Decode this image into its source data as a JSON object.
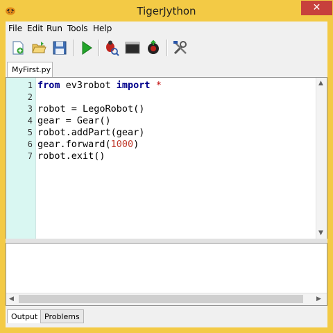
{
  "window": {
    "title": "TigerJython",
    "close_glyph": "✕"
  },
  "menu": [
    "File",
    "Edit",
    "Run",
    "Tools",
    "Help"
  ],
  "toolbar": {
    "buttons": [
      "new-file-icon",
      "open-folder-icon",
      "save-disk-icon",
      "run-play-icon",
      "debug-bug-icon",
      "console-terminal-icon",
      "robot-upload-icon",
      "tools-wrench-icon"
    ]
  },
  "tabs": {
    "active_file": "MyFirst.py"
  },
  "editor": {
    "line_numbers": [
      "1",
      "2",
      "3",
      "4",
      "5",
      "6",
      "7"
    ],
    "code": [
      [
        {
          "t": "from",
          "c": "kw"
        },
        {
          "t": " ev3robot ",
          "c": ""
        },
        {
          "t": "import",
          "c": "kw"
        },
        {
          "t": " ",
          "c": ""
        },
        {
          "t": "*",
          "c": "op"
        }
      ],
      [],
      [
        {
          "t": "robot = LegoRobot()",
          "c": ""
        }
      ],
      [
        {
          "t": "gear = Gear()",
          "c": ""
        }
      ],
      [
        {
          "t": "robot.addPart(gear)",
          "c": ""
        }
      ],
      [
        {
          "t": "gear.forward(",
          "c": ""
        },
        {
          "t": "1000",
          "c": "num"
        },
        {
          "t": ")",
          "c": ""
        }
      ],
      [
        {
          "t": "robot.exit()",
          "c": ""
        }
      ]
    ]
  },
  "bottom_tabs": [
    "Output",
    "Problems"
  ],
  "colors": {
    "titlebar": "#f3ca45",
    "close": "#c7403c",
    "gutter": "#d9f7f2",
    "keyword": "#00008b",
    "number": "#c0392b"
  }
}
